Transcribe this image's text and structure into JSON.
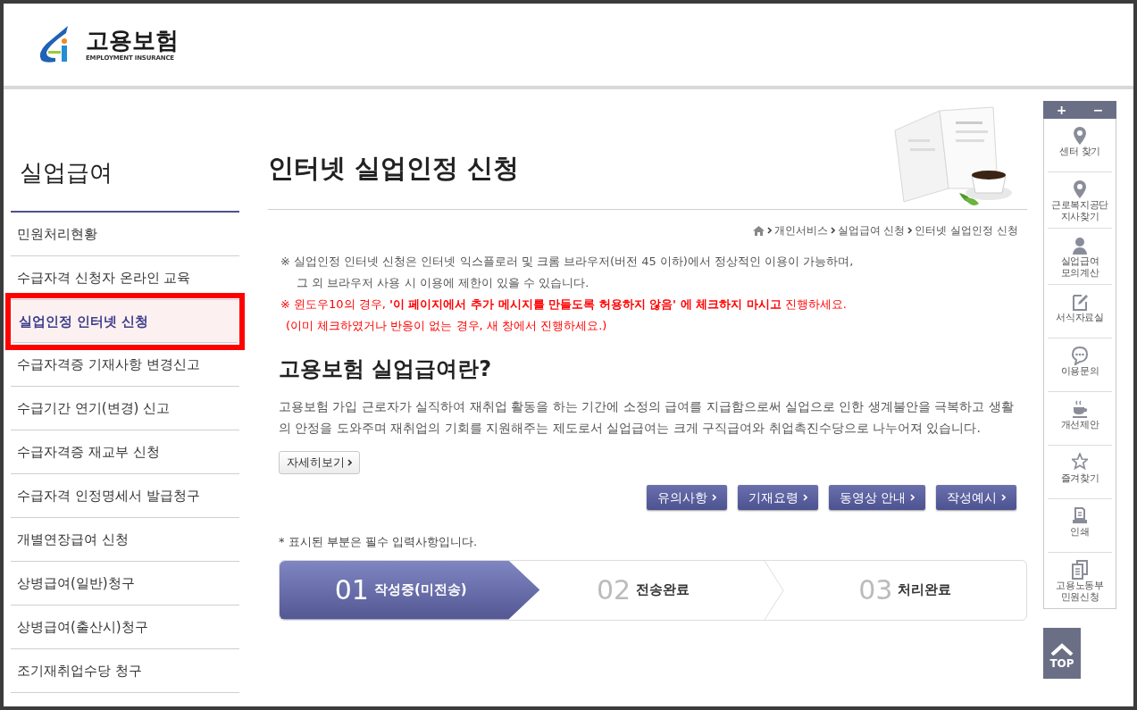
{
  "header": {
    "logo_text": "고용보험",
    "logo_subtext": "EMPLOYMENT INSURANCE"
  },
  "sidebar": {
    "title": "실업급여",
    "items": [
      {
        "label": "민원처리현황",
        "selected": false
      },
      {
        "label": "수급자격 신청자 온라인 교육",
        "selected": false
      },
      {
        "label": "실업인정 인터넷 신청",
        "selected": true
      },
      {
        "label": "수급자격증 기재사항 변경신고",
        "selected": false
      },
      {
        "label": "수급기간 연기(변경) 신고",
        "selected": false
      },
      {
        "label": "수급자격증 재교부 신청",
        "selected": false
      },
      {
        "label": "수급자격 인정명세서 발급청구",
        "selected": false
      },
      {
        "label": "개별연장급여 신청",
        "selected": false
      },
      {
        "label": "상병급여(일반)청구",
        "selected": false
      },
      {
        "label": "상병급여(출산시)청구",
        "selected": false
      },
      {
        "label": "조기재취업수당 청구",
        "selected": false
      }
    ]
  },
  "page_title": "인터넷 실업인정 신청",
  "breadcrumb": [
    "개인서비스",
    "실업급여 신청",
    "인터넷 실업인정 신청"
  ],
  "notices": [
    {
      "kind": "normal",
      "lines": [
        "※ 실업인정 인터넷 신청은 인터넷 익스플로러 및 크롬 브라우저(버전 45 이하)에서 정상적인 이용이 가능하며,",
        "그 외 브라우저 사용 시 이용에 제한이 있을 수 있습니다."
      ]
    },
    {
      "kind": "warning",
      "lines": [
        "※ 윈도우10의 경우, **'이 페이지에서 추가 메시지를 만들도록 허용하지 않음' 에 체크하지 마시고** 진행하세요.",
        "(이미 체크하였거나 반응이 없는 경우, 새 창에서 진행하세요.)"
      ]
    }
  ],
  "section": {
    "title": "고용보험 실업급여란?",
    "description": "고용보험 가입 근로자가 실직하여 재취업 활동을 하는 기간에 소정의 급여를 지급함으로써 실업으로 인한 생계불안을 극복하고 생활의 안정을 도와주며 재취업의 기회를 지원해주는 제도로서 실업급여는 크게 구직급여와 취업촉진수당으로 나누어져 있습니다.",
    "more_button": "자세히보기"
  },
  "action_buttons": [
    "유의사항",
    "기재요령",
    "동영상 안내",
    "작성예시"
  ],
  "required_note": "* 표시된 부분은 필수 입력사항입니다.",
  "steps": [
    {
      "number": "01",
      "label": "작성중(미전송)",
      "selected": true
    },
    {
      "number": "02",
      "label": "전송완료",
      "selected": false
    },
    {
      "number": "03",
      "label": "처리완료",
      "selected": false
    }
  ],
  "quick_menu": {
    "zoom_in": "+",
    "zoom_out": "−",
    "items": [
      {
        "lines": [
          "센터 찾기"
        ]
      },
      {
        "lines": [
          "근로복지공단",
          "지사찾기"
        ]
      },
      {
        "lines": [
          "실업급여",
          "모의계산"
        ]
      },
      {
        "lines": [
          "서식자료실"
        ]
      },
      {
        "lines": [
          "이용문의"
        ]
      },
      {
        "lines": [
          "개선제안"
        ]
      },
      {
        "lines": [
          "즐겨찾기"
        ]
      },
      {
        "lines": [
          "인쇄"
        ]
      },
      {
        "lines": [
          "고용노동부",
          "민원신청"
        ]
      }
    ],
    "top_button": "TOP"
  }
}
